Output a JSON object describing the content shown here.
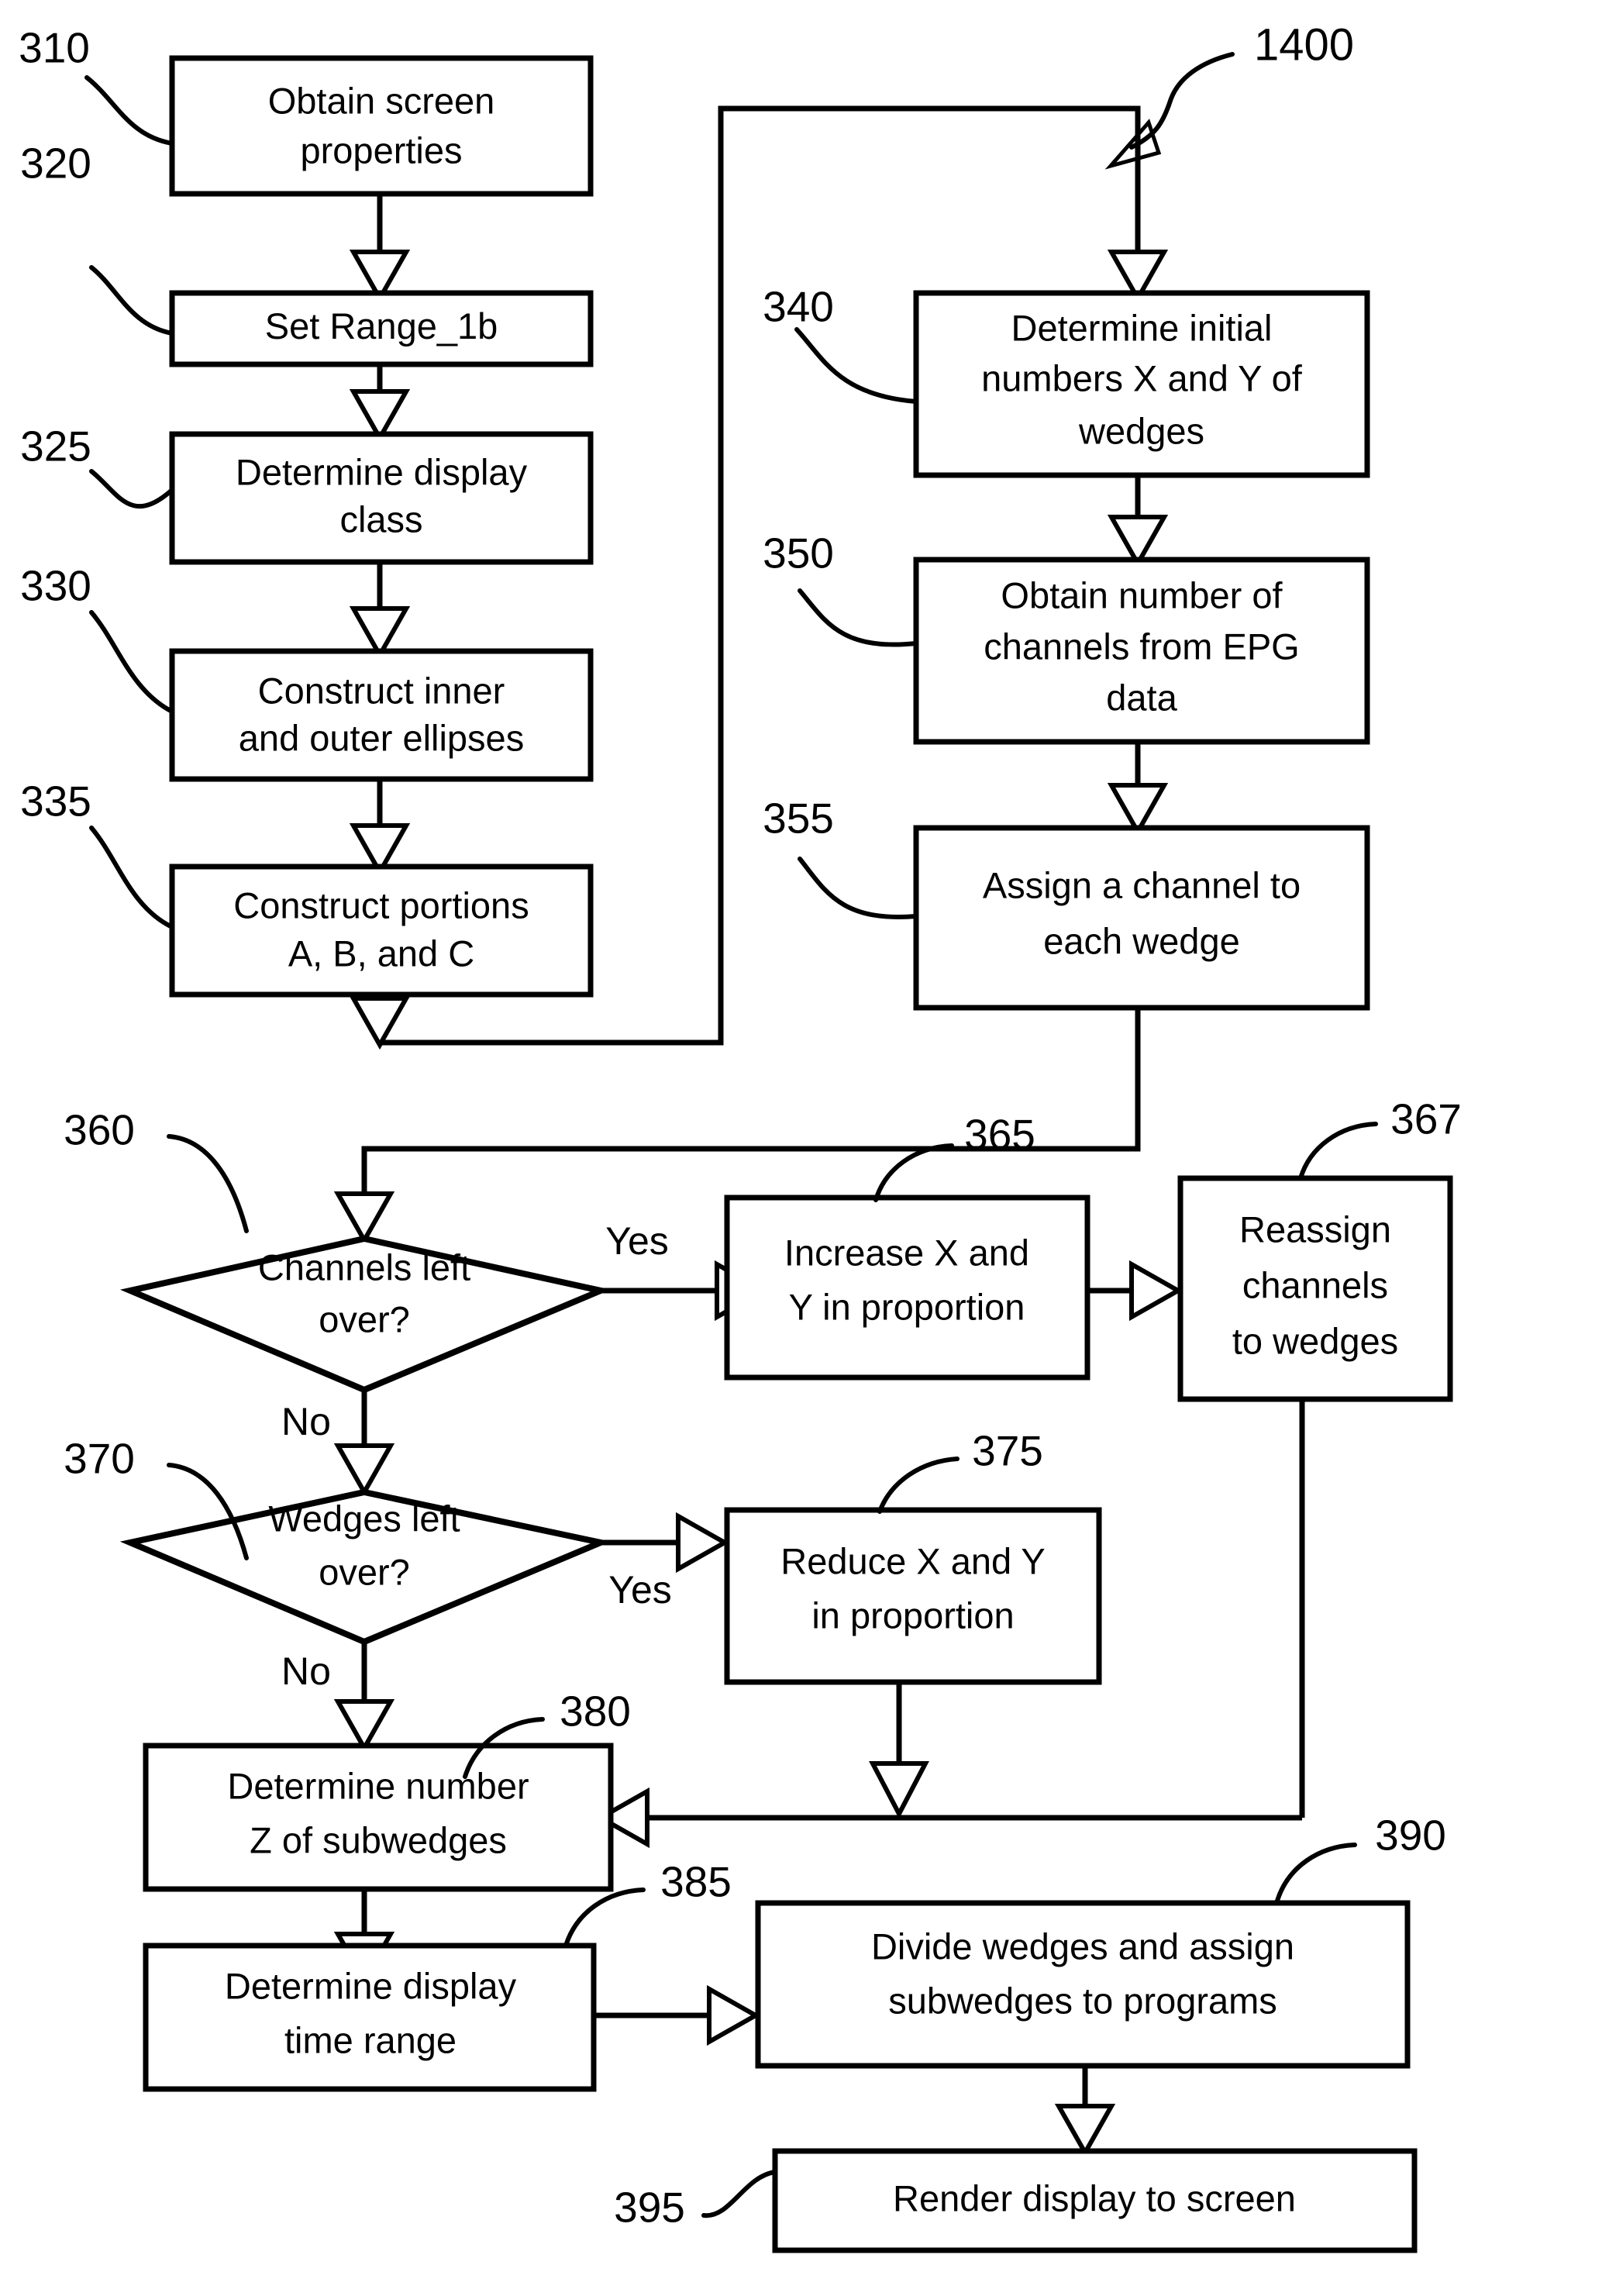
{
  "figure": {
    "number_label": "1400"
  },
  "nodes": [
    {
      "ref": "310",
      "type": "process",
      "lines": [
        "Obtain screen",
        "properties"
      ]
    },
    {
      "ref": "320",
      "type": "process",
      "lines": [
        "Set Range_1b"
      ],
      "italic_part": "Range_1b",
      "plain_part": "Set "
    },
    {
      "ref": "325",
      "type": "process",
      "lines": [
        "Determine display",
        "class"
      ]
    },
    {
      "ref": "330",
      "type": "process",
      "lines": [
        "Construct inner",
        "and outer ellipses"
      ]
    },
    {
      "ref": "335",
      "type": "process",
      "lines": [
        "Construct portions",
        "A, B, and C"
      ]
    },
    {
      "ref": "340",
      "type": "process",
      "lines": [
        "Determine initial",
        "numbers X and Y of",
        "wedges"
      ]
    },
    {
      "ref": "350",
      "type": "process",
      "lines": [
        "Obtain number of",
        "channels from EPG",
        "data"
      ]
    },
    {
      "ref": "355",
      "type": "process",
      "lines": [
        "Assign a channel to",
        "each wedge"
      ]
    },
    {
      "ref": "360",
      "type": "decision",
      "lines": [
        "Channels left",
        "over?"
      ]
    },
    {
      "ref": "365",
      "type": "process",
      "lines": [
        "Increase X and",
        "Y in proportion"
      ]
    },
    {
      "ref": "367",
      "type": "process",
      "lines": [
        "Reassign",
        "channels",
        "to wedges"
      ]
    },
    {
      "ref": "370",
      "type": "decision",
      "lines": [
        "Wedges left",
        "over?"
      ]
    },
    {
      "ref": "375",
      "type": "process",
      "lines": [
        "Reduce X and Y",
        "in proportion"
      ]
    },
    {
      "ref": "380",
      "type": "process",
      "lines": [
        "Determine number",
        "Z of subwedges"
      ]
    },
    {
      "ref": "385",
      "type": "process",
      "lines": [
        "Determine display",
        "time range"
      ]
    },
    {
      "ref": "390",
      "type": "process",
      "lines": [
        "Divide wedges and assign",
        "subwedges to programs"
      ]
    },
    {
      "ref": "395",
      "type": "process",
      "lines": [
        "Render display to screen"
      ]
    }
  ],
  "edge_labels": {
    "yes_360": "Yes",
    "no_360": "No",
    "yes_370": "Yes",
    "no_370": "No"
  },
  "text": {
    "n310_l1": "Obtain screen",
    "n310_l2": "properties",
    "n320_plain": "Set ",
    "n320_italic": "Range_1b",
    "n325_l1": "Determine display",
    "n325_l2": "class",
    "n330_l1": "Construct inner",
    "n330_l2": "and outer ellipses",
    "n335_l1": "Construct portions",
    "n335_l2": "A, B, and C",
    "n340_l1": "Determine initial",
    "n340_l2": "numbers X and Y of",
    "n340_l3": "wedges",
    "n350_l1": "Obtain number of",
    "n350_l2": "channels from EPG",
    "n350_l3": "data",
    "n355_l1": "Assign a channel to",
    "n355_l2": "each wedge",
    "n360_l1": "Channels left",
    "n360_l2": "over?",
    "n365_l1": "Increase X and",
    "n365_l2": "Y in proportion",
    "n367_l1": "Reassign",
    "n367_l2": "channels",
    "n367_l3": "to wedges",
    "n370_l1": "Wedges left",
    "n370_l2": "over?",
    "n375_l1": "Reduce X and Y",
    "n375_l2": "in proportion",
    "n380_l1": "Determine number",
    "n380_l2": "Z of subwedges",
    "n385_l1": "Determine display",
    "n385_l2": "time range",
    "n390_l1": "Divide wedges and assign",
    "n390_l2": "subwedges to programs",
    "n395_l1": "Render display to screen"
  },
  "refs": {
    "r310": "310",
    "r320": "320",
    "r325": "325",
    "r330": "330",
    "r335": "335",
    "r340": "340",
    "r350": "350",
    "r355": "355",
    "r360": "360",
    "r365": "365",
    "r367": "367",
    "r370": "370",
    "r375": "375",
    "r380": "380",
    "r385": "385",
    "r390": "390",
    "r395": "395",
    "fig": "1400"
  },
  "colors": {
    "ink": "#000000",
    "paper": "#ffffff"
  }
}
